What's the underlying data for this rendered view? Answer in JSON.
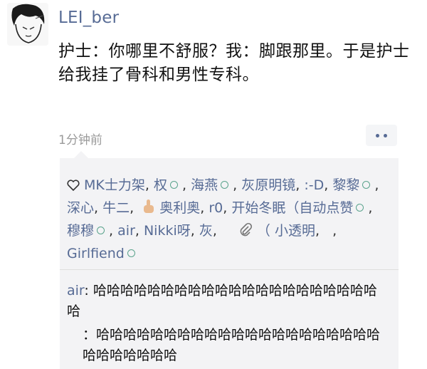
{
  "post": {
    "username": "LEI_ber",
    "text": "护士：你哪里不舒服？我：脚跟那里。于是护士给我挂了骨科和男性专科。",
    "timestamp": "1分钟前"
  },
  "likes": {
    "names": [
      "MK士力架",
      "权",
      "海燕",
      "灰原明镜",
      ":-D",
      "黎黎",
      "深心",
      "牛二",
      "奥利奥",
      "r0",
      "开始冬眠（自动点赞",
      "穆穆",
      "air",
      "Nikki呀",
      "灰",
      "（ 小透明",
      "Girlfiend"
    ]
  },
  "comments": [
    {
      "author": "air",
      "sep": ": ",
      "text": "哈哈哈哈哈哈哈哈哈哈哈哈哈哈哈哈哈哈哈哈哈哈"
    },
    {
      "author": "",
      "sep": "：",
      "text": "哈哈哈哈哈哈哈哈哈哈哈哈哈哈哈哈哈哈哈哈哈哈哈哈哈哈哈哈"
    }
  ],
  "colors": {
    "link": "#576b95",
    "panel": "#f3f3f5",
    "badge": "#5aa38c"
  },
  "icons": [
    "avatar-cartoon",
    "heart-outline-icon",
    "finger-emoji-icon",
    "paperclip-icon",
    "more-dots-icon"
  ]
}
